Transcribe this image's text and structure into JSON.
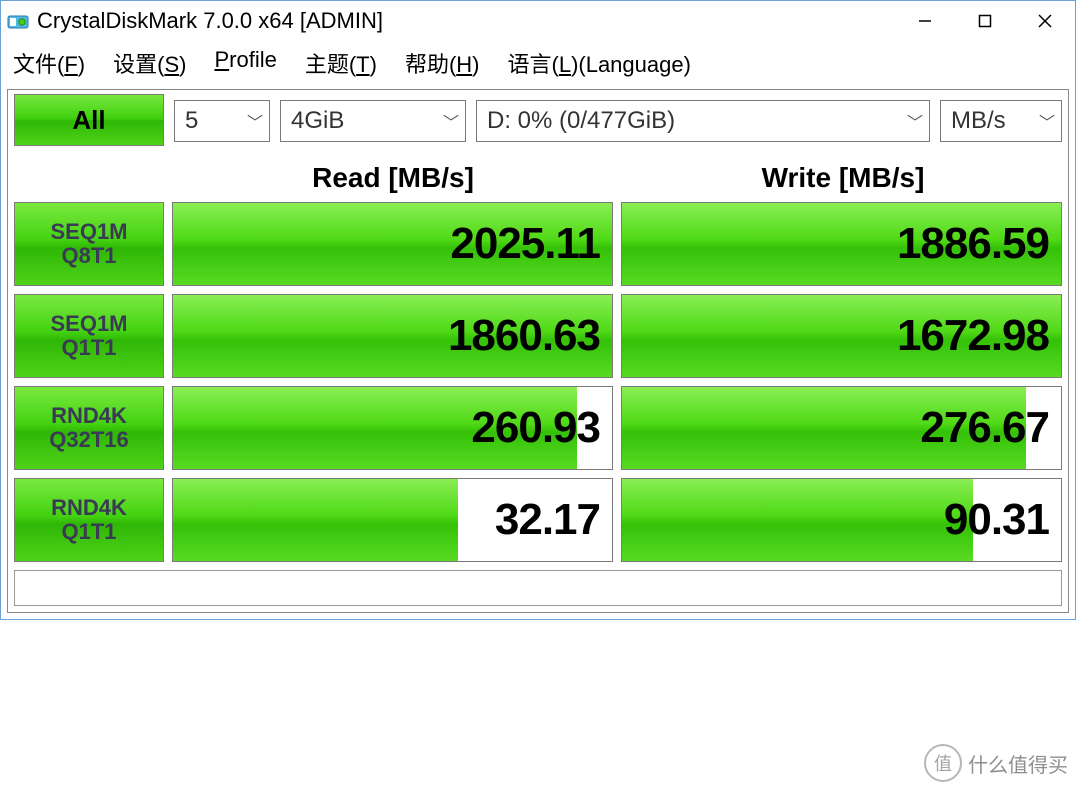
{
  "title": "CrystalDiskMark 7.0.0 x64 [ADMIN]",
  "menu": {
    "file": "文件(F)",
    "settings": "设置(S)",
    "profile": "Profile",
    "theme": "主题(T)",
    "help": "帮助(H)",
    "language": "语言(L)(Language)"
  },
  "controls": {
    "all": "All",
    "count": "5",
    "size": "4GiB",
    "drive": "D: 0% (0/477GiB)",
    "unit": "MB/s"
  },
  "headers": {
    "read": "Read [MB/s]",
    "write": "Write [MB/s]"
  },
  "rows": [
    {
      "label1": "SEQ1M",
      "label2": "Q8T1",
      "read": "2025.11",
      "write": "1886.59",
      "read_pct": 100,
      "write_pct": 100
    },
    {
      "label1": "SEQ1M",
      "label2": "Q1T1",
      "read": "1860.63",
      "write": "1672.98",
      "read_pct": 100,
      "write_pct": 100
    },
    {
      "label1": "RND4K",
      "label2": "Q32T16",
      "read": "260.93",
      "write": "276.67",
      "read_pct": 92,
      "write_pct": 92
    },
    {
      "label1": "RND4K",
      "label2": "Q1T1",
      "read": "32.17",
      "write": "90.31",
      "read_pct": 65,
      "write_pct": 80
    }
  ],
  "watermark": {
    "char": "值",
    "text": "什么值得买"
  }
}
